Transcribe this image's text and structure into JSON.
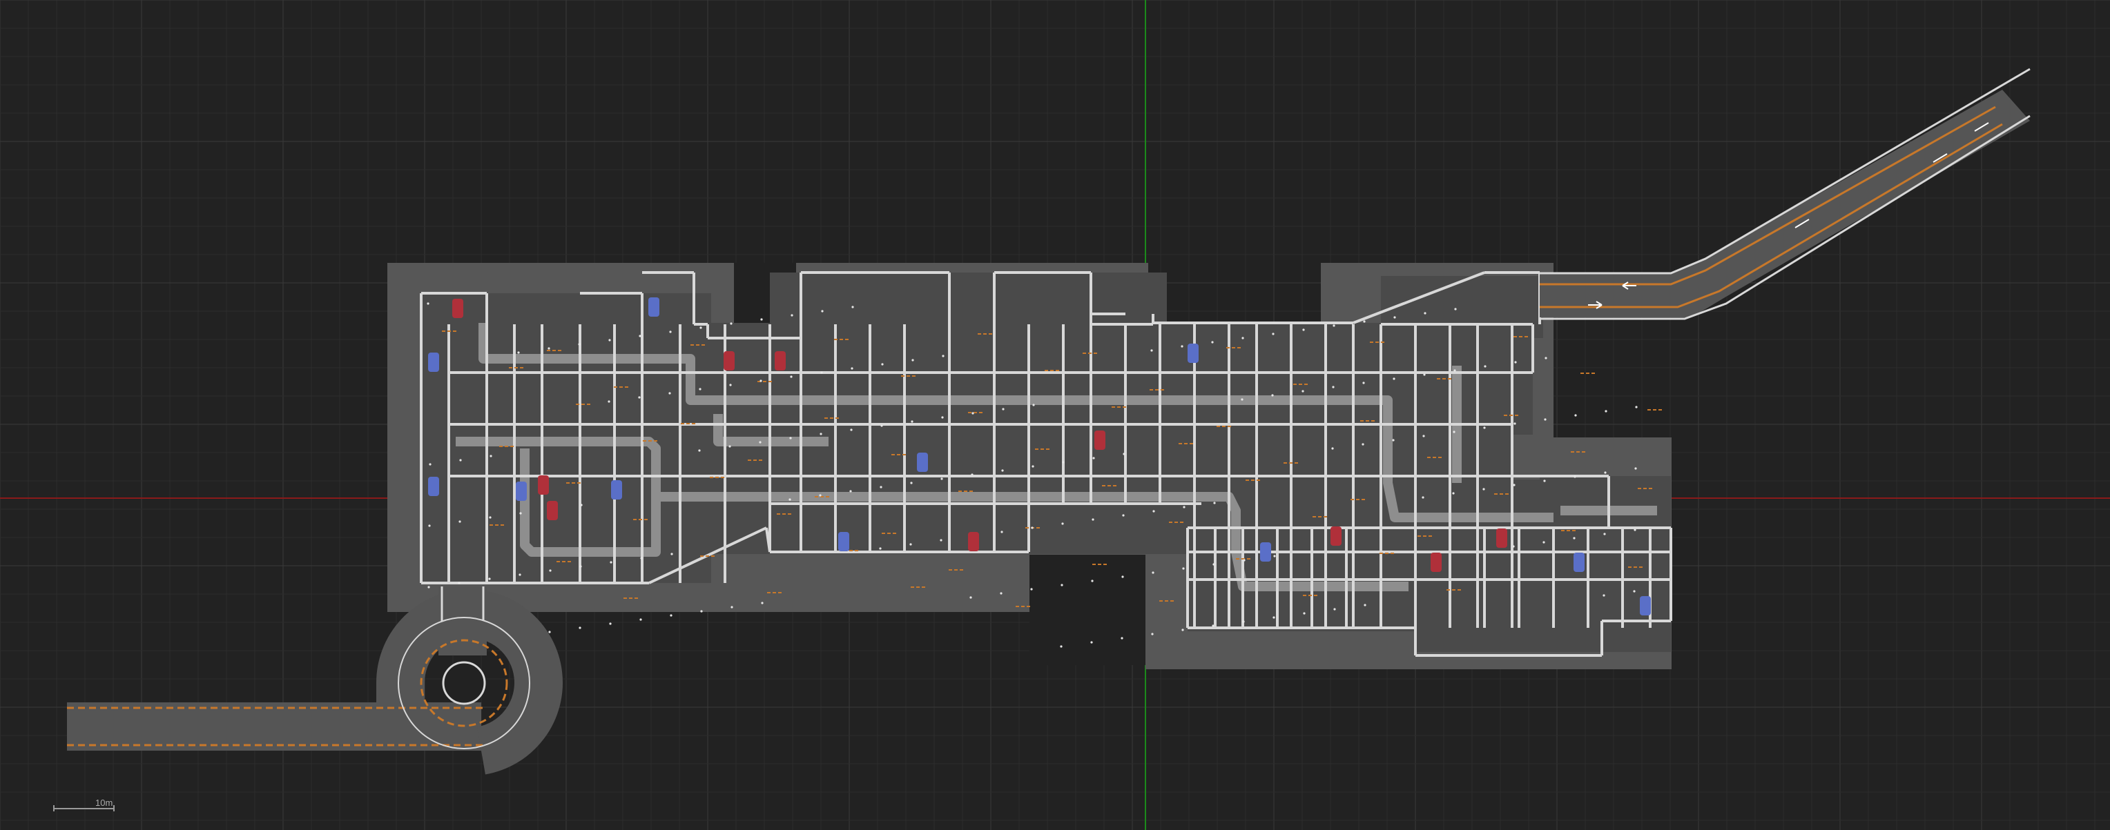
{
  "viewport": {
    "background_color": "#222222",
    "grid_minor_color": "#2c2c2c",
    "grid_major_color": "#3a3a3a",
    "axis_x_color": "#8a1a1a",
    "axis_y_color": "#1b8a1b"
  },
  "floorplan": {
    "slab_color": "#575757",
    "floor_color": "#4c4c4c",
    "wall_color": "#d8d8d8",
    "duct_color": "#8e8e8e",
    "marking_color": "#c8782a",
    "vehicle_colors": {
      "red": "#b0303a",
      "blue": "#5a6fc8"
    },
    "vehicle_count_red": 10,
    "vehicle_count_blue": 11,
    "ramps": [
      {
        "name": "spiral-entry-ramp",
        "color": "#555555"
      },
      {
        "name": "diagonal-exit-ramp",
        "color": "#555555"
      }
    ]
  },
  "scale_bar": {
    "label": "10m"
  }
}
